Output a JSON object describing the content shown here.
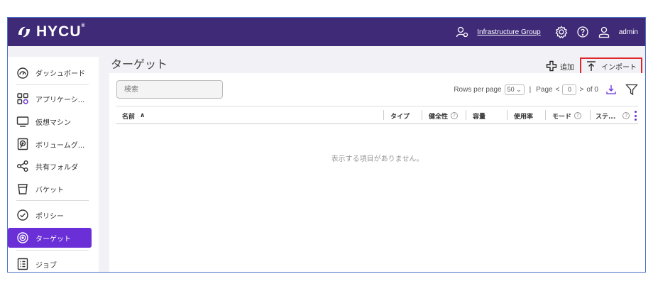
{
  "header": {
    "logo_text": "HYCU",
    "logo_mark": "®",
    "group_link": "Infrastructure Group",
    "user": "admin"
  },
  "sidebar": {
    "items": [
      {
        "label": "ダッシュボード",
        "icon": "dashboard-icon"
      },
      {
        "label": "アプリケーシ...",
        "icon": "applications-icon"
      },
      {
        "label": "仮想マシン",
        "icon": "monitor-icon"
      },
      {
        "label": "ボリュームグ...",
        "icon": "volume-group-icon"
      },
      {
        "label": "共有フォルダ",
        "icon": "share-icon"
      },
      {
        "label": "バケット",
        "icon": "bucket-icon"
      },
      {
        "label": "ポリシー",
        "icon": "shield-check-icon"
      },
      {
        "label": "ターゲット",
        "icon": "target-icon",
        "active": true
      },
      {
        "label": "ジョブ",
        "icon": "jobs-icon"
      }
    ]
  },
  "main": {
    "title": "ターゲット",
    "add_label": "追加",
    "import_label": "インポート",
    "search_placeholder": "検索",
    "pager": {
      "rows_label": "Rows per page",
      "rows_value": "50",
      "page_label": "Page",
      "page_value": "0",
      "of_label": "of 0"
    },
    "columns": [
      {
        "label": "名前",
        "sort": "∧"
      },
      {
        "label": "タイプ"
      },
      {
        "label": "健全性",
        "help": true
      },
      {
        "label": "容量"
      },
      {
        "label": "使用率"
      },
      {
        "label": "モード",
        "help": true
      },
      {
        "label": "ステ...",
        "help": true
      }
    ],
    "empty_message": "表示する項目がありません。"
  },
  "colors": {
    "topbar": "#3f2a78",
    "accent": "#6a2fd6",
    "highlight_box": "#e0262b"
  }
}
